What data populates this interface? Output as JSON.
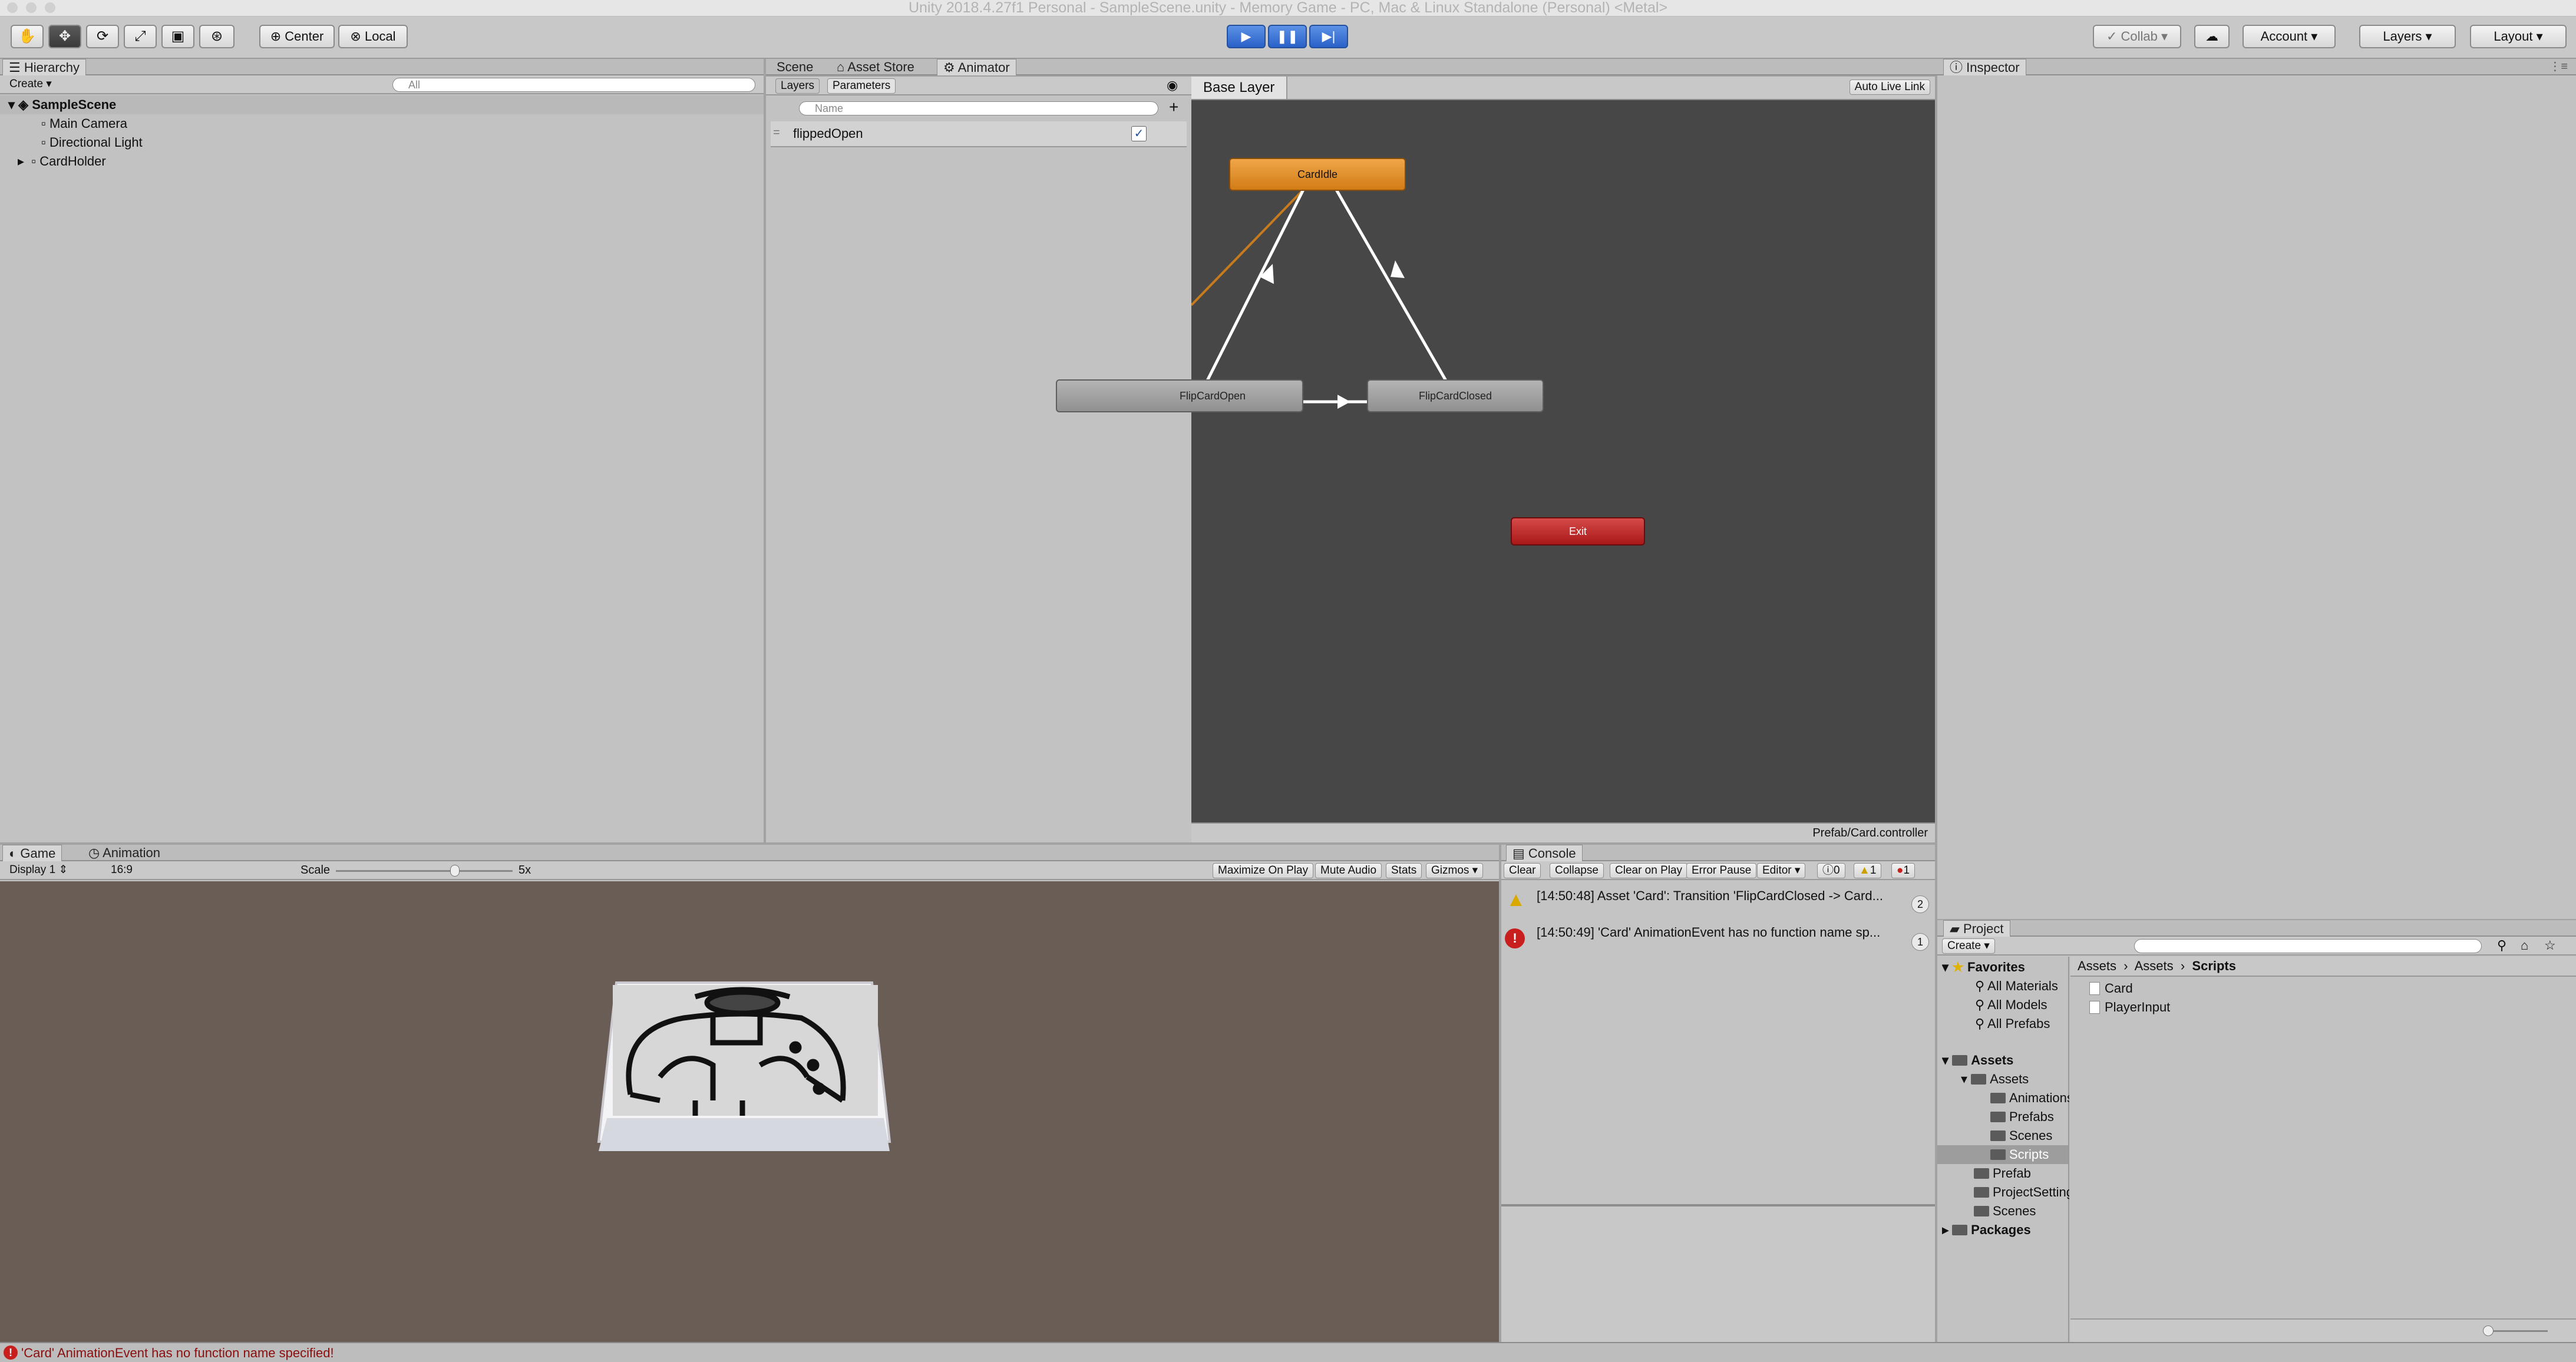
{
  "window": {
    "title": "Unity 2018.4.27f1 Personal - SampleScene.unity - Memory Game - PC, Mac & Linux Standalone (Personal) <Metal>"
  },
  "toolbar": {
    "tools": [
      {
        "name": "hand-tool-icon",
        "glyph": "✋"
      },
      {
        "name": "move-tool-icon",
        "glyph": "✥"
      },
      {
        "name": "rotate-tool-icon",
        "glyph": "⟳"
      },
      {
        "name": "scale-tool-icon",
        "glyph": "⤢"
      },
      {
        "name": "rect-tool-icon",
        "glyph": "▣"
      },
      {
        "name": "transform-tool-icon",
        "glyph": "⊛"
      }
    ],
    "center_label": "Center",
    "local_label": "Local",
    "collab_label": "Collab",
    "account_label": "Account",
    "layers_label": "Layers",
    "layout_label": "Layout"
  },
  "hierarchy": {
    "tab_label": "Hierarchy",
    "create_label": "Create",
    "search_placeholder": "All",
    "scene_name": "SampleScene",
    "items": [
      "Main Camera",
      "Directional Light",
      "CardHolder"
    ]
  },
  "center_tabs": {
    "scene": "Scene",
    "asset_store": "Asset Store",
    "animator": "Animator"
  },
  "animator": {
    "layers_tab": "Layers",
    "parameters_tab": "Parameters",
    "name_placeholder": "Name",
    "parameter": {
      "name": "flippedOpen",
      "checked": true
    },
    "base_layer": "Base Layer",
    "auto_live_link": "Auto Live Link",
    "nodes": {
      "idle": "CardIdle",
      "open": "FlipCardOpen",
      "closed": "FlipCardClosed",
      "exit": "Exit"
    },
    "footer_path": "Prefab/Card.controller"
  },
  "inspector": {
    "tab_label": "Inspector"
  },
  "game": {
    "game_tab": "Game",
    "animation_tab": "Animation",
    "display": "Display 1",
    "aspect": "16:9",
    "scale_label": "Scale",
    "scale_value": "5x",
    "maximize_on_play": "Maximize On Play",
    "mute_audio": "Mute Audio",
    "stats": "Stats",
    "gizmos": "Gizmos"
  },
  "console": {
    "tab_label": "Console",
    "clear": "Clear",
    "collapse": "Collapse",
    "clear_on_play": "Clear on Play",
    "error_pause": "Error Pause",
    "editor": "Editor",
    "info_count": "0",
    "warn_count": "1",
    "error_count": "1",
    "entries": [
      {
        "type": "warning",
        "text": "[14:50:48] Asset 'Card': Transition 'FlipCardClosed -> Card...",
        "count": "2"
      },
      {
        "type": "error",
        "text": "[14:50:49] 'Card' AnimationEvent has no function name sp...",
        "count": "1"
      }
    ]
  },
  "project": {
    "tab_label": "Project",
    "create_label": "Create",
    "favorites_label": "Favorites",
    "favorites": [
      "All Materials",
      "All Models",
      "All Prefabs"
    ],
    "assets_label": "Assets",
    "tree": [
      "Assets",
      "Animations",
      "Prefabs",
      "Scenes",
      "Scripts",
      "Prefab",
      "ProjectSettings",
      "Scenes"
    ],
    "packages_label": "Packages",
    "breadcrumb": [
      "Assets",
      "Assets",
      "Scripts"
    ],
    "files": [
      "Card",
      "PlayerInput"
    ]
  },
  "status": {
    "message": "'Card' AnimationEvent has no function name specified!"
  }
}
